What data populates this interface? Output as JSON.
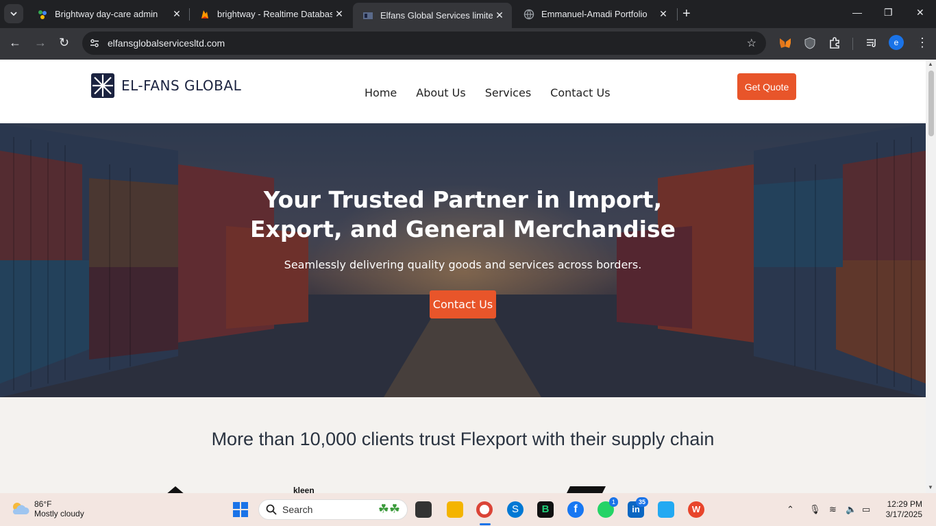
{
  "browser": {
    "tabs": [
      {
        "title": "Brightway day-care admin",
        "favicon": "people-icon",
        "active": false
      },
      {
        "title": "brightway - Realtime Database",
        "favicon": "firebase-icon",
        "active": false
      },
      {
        "title": "Elfans Global Services limited",
        "favicon": "site-icon",
        "active": true
      },
      {
        "title": "Emmanuel-Amadi Portfolio",
        "favicon": "globe-icon",
        "active": false
      }
    ],
    "url": "elfansglobalservicesltd.com",
    "profile_initial": "e"
  },
  "site": {
    "logo_text": "EL-FANS GLOBAL",
    "nav": [
      "Home",
      "About Us",
      "Services",
      "Contact Us"
    ],
    "quote_button": "Get Quote",
    "hero": {
      "title_line1": "Your Trusted Partner in Import,",
      "title_line2": "Export, and General Merchandise",
      "subtitle": "Seamlessly delivering quality goods and services across borders.",
      "cta": "Contact Us"
    },
    "trust_heading": "More than 10,000 clients trust Flexport with their supply chain",
    "client_logo_text": "kleen"
  },
  "taskbar": {
    "weather_temp": "86°F",
    "weather_cond": "Mostly cloudy",
    "search_placeholder": "Search",
    "whatsapp_badge": "1",
    "linkedin_badge": "35",
    "time": "12:29 PM",
    "date": "3/17/2025"
  },
  "colors": {
    "accent": "#e8552a",
    "logo_navy": "#1b2340"
  }
}
